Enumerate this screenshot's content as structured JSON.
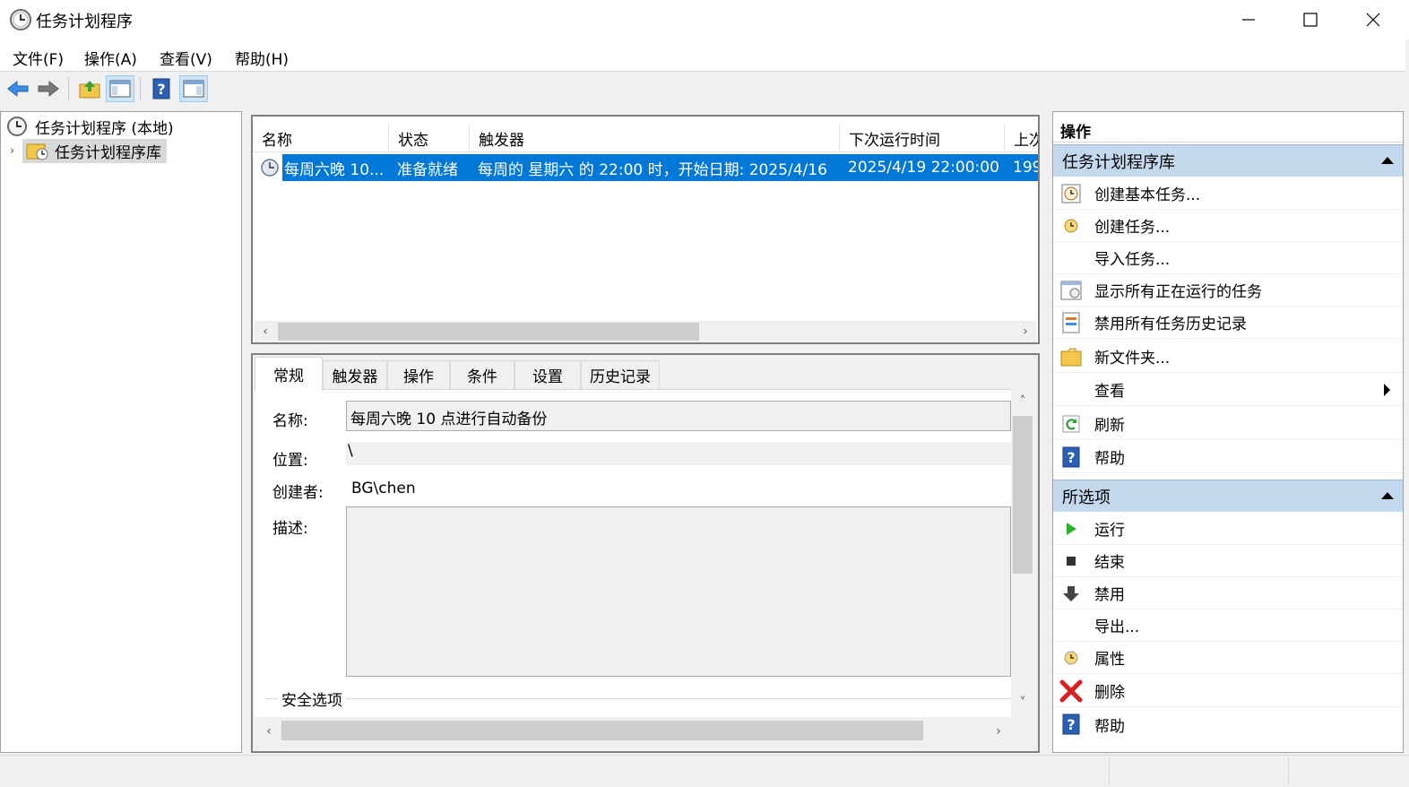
{
  "window": {
    "title": "任务计划程序",
    "icon": "clock-icon",
    "controls": [
      "minimize-icon",
      "maximize-icon",
      "close-icon"
    ]
  },
  "menu": {
    "items": [
      {
        "label": "文件(F)"
      },
      {
        "label": "操作(A)"
      },
      {
        "label": "查看(V)"
      },
      {
        "label": "帮助(H)"
      }
    ]
  },
  "toolbar": {
    "buttons": [
      "back-arrow-icon",
      "forward-arrow-icon",
      "up-folder-icon",
      "show-hide-tree-icon",
      "help-icon",
      "show-hide-action-pane-icon"
    ]
  },
  "tree": {
    "root_label": "任务计划程序 (本地)",
    "library_label": "任务计划程序库"
  },
  "task_list": {
    "columns": [
      "名称",
      "状态",
      "触发器",
      "下次运行时间",
      "上次"
    ],
    "rows": [
      {
        "name": "每周六晚 10...",
        "status": "准备就绪",
        "trigger": "每周的 星期六 的 22:00 时，开始日期: 2025/4/16",
        "next_run": "2025/4/19 22:00:00",
        "last_run": "199"
      }
    ],
    "selection_color": "#0078d7"
  },
  "details": {
    "tabs": [
      "常规",
      "触发器",
      "操作",
      "条件",
      "设置",
      "历史记录"
    ],
    "active_tab": "常规",
    "name_label": "名称:",
    "name_value": "每周六晚 10 点进行自动备份",
    "location_label": "位置:",
    "location_value": "\\",
    "author_label": "创建者:",
    "author_value": "BG\\chen",
    "description_label": "描述:",
    "description_value": "",
    "security_legend": "安全选项"
  },
  "actions": {
    "title": "操作",
    "library_section": {
      "header": "任务计划程序库",
      "items": [
        {
          "label": "创建基本任务...",
          "icon": "create-basic-task-icon"
        },
        {
          "label": "创建任务...",
          "icon": "create-task-icon"
        },
        {
          "label": "导入任务...",
          "icon": ""
        },
        {
          "label": "显示所有正在运行的任务",
          "icon": "running-tasks-icon"
        },
        {
          "label": "禁用所有任务历史记录",
          "icon": "history-icon"
        },
        {
          "label": "新文件夹...",
          "icon": "new-folder-icon"
        },
        {
          "label": "查看",
          "icon": ""
        },
        {
          "label": "刷新",
          "icon": "refresh-icon"
        },
        {
          "label": "帮助",
          "icon": "help-icon"
        }
      ]
    },
    "selected_section": {
      "header": "所选项",
      "items": [
        {
          "label": "运行",
          "icon": "run-icon"
        },
        {
          "label": "结束",
          "icon": "stop-icon"
        },
        {
          "label": "禁用",
          "icon": "disable-icon"
        },
        {
          "label": "导出...",
          "icon": ""
        },
        {
          "label": "属性",
          "icon": "properties-icon"
        },
        {
          "label": "删除",
          "icon": "delete-icon"
        },
        {
          "label": "帮助",
          "icon": "help-icon"
        }
      ]
    }
  }
}
